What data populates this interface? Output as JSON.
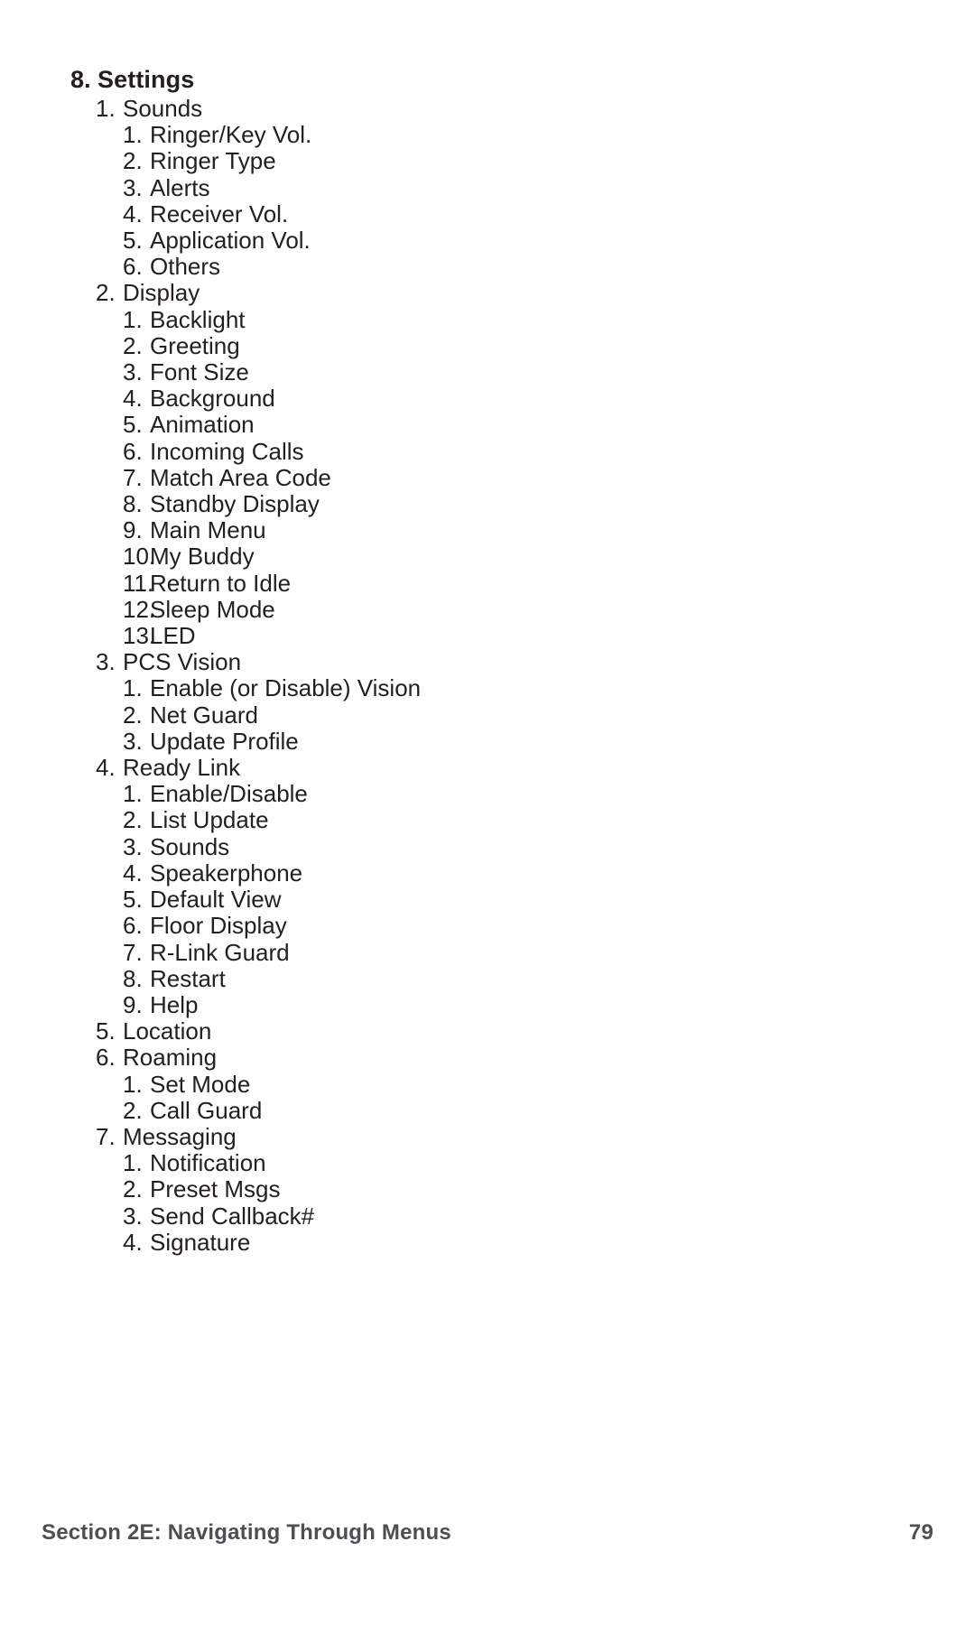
{
  "document": {
    "heading": {
      "number": "8.",
      "label": "Settings"
    },
    "items": [
      {
        "number": "1.",
        "label": "Sounds",
        "level": 2
      },
      {
        "number": "1.",
        "label": "Ringer/Key Vol.",
        "level": 3
      },
      {
        "number": "2.",
        "label": "Ringer Type",
        "level": 3
      },
      {
        "number": "3.",
        "label": "Alerts",
        "level": 3
      },
      {
        "number": "4.",
        "label": "Receiver Vol.",
        "level": 3
      },
      {
        "number": "5.",
        "label": "Application Vol.",
        "level": 3
      },
      {
        "number": "6.",
        "label": "Others",
        "level": 3
      },
      {
        "number": "2.",
        "label": "Display",
        "level": 2
      },
      {
        "number": "1.",
        "label": "Backlight",
        "level": 3
      },
      {
        "number": "2.",
        "label": "Greeting",
        "level": 3
      },
      {
        "number": "3.",
        "label": "Font Size",
        "level": 3
      },
      {
        "number": "4.",
        "label": "Background",
        "level": 3
      },
      {
        "number": "5.",
        "label": "Animation",
        "level": 3
      },
      {
        "number": "6.",
        "label": "Incoming Calls",
        "level": 3
      },
      {
        "number": "7.",
        "label": "Match Area Code",
        "level": 3
      },
      {
        "number": "8.",
        "label": "Standby Display",
        "level": 3
      },
      {
        "number": "9.",
        "label": "Main Menu",
        "level": 3
      },
      {
        "number": "10.",
        "label": "My Buddy",
        "level": 3
      },
      {
        "number": "11.",
        "label": "Return to Idle",
        "level": 3
      },
      {
        "number": "12.",
        "label": "Sleep Mode",
        "level": 3
      },
      {
        "number": "13.",
        "label": "LED",
        "level": 3
      },
      {
        "number": "3.",
        "label": "PCS Vision",
        "level": 2
      },
      {
        "number": "1.",
        "label": "Enable (or Disable) Vision",
        "level": 3
      },
      {
        "number": "2.",
        "label": "Net Guard",
        "level": 3
      },
      {
        "number": "3.",
        "label": "Update Profile",
        "level": 3
      },
      {
        "number": "4.",
        "label": "Ready Link",
        "level": 2
      },
      {
        "number": "1.",
        "label": "Enable/Disable",
        "level": 3
      },
      {
        "number": "2.",
        "label": "List Update",
        "level": 3
      },
      {
        "number": "3.",
        "label": "Sounds",
        "level": 3
      },
      {
        "number": "4.",
        "label": "Speakerphone",
        "level": 3
      },
      {
        "number": "5.",
        "label": "Default View",
        "level": 3
      },
      {
        "number": "6.",
        "label": "Floor Display",
        "level": 3
      },
      {
        "number": "7.",
        "label": "R-Link Guard",
        "level": 3
      },
      {
        "number": "8.",
        "label": "Restart",
        "level": 3
      },
      {
        "number": "9.",
        "label": "Help",
        "level": 3
      },
      {
        "number": "5.",
        "label": "Location",
        "level": 2
      },
      {
        "number": "6.",
        "label": "Roaming",
        "level": 2
      },
      {
        "number": "1.",
        "label": "Set Mode",
        "level": 3
      },
      {
        "number": "2.",
        "label": "Call Guard",
        "level": 3
      },
      {
        "number": "7.",
        "label": "Messaging",
        "level": 2
      },
      {
        "number": "1.",
        "label": "Notification",
        "level": 3
      },
      {
        "number": "2.",
        "label": "Preset Msgs",
        "level": 3
      },
      {
        "number": "3.",
        "label": "Send Callback#",
        "level": 3
      },
      {
        "number": "4.",
        "label": "Signature",
        "level": 3
      }
    ]
  },
  "footer": {
    "section_title": "Section 2E: Navigating Through Menus",
    "page_number": "79"
  }
}
